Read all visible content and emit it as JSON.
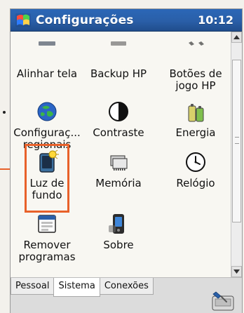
{
  "window": {
    "title": "Configurações",
    "clock": "10:12"
  },
  "items": [
    {
      "label": "Alinhar tela",
      "icon": "screen-align-icon"
    },
    {
      "label": "Backup HP",
      "icon": "backup-icon"
    },
    {
      "label": "Botões de\njogo HP",
      "icon": "game-buttons-icon"
    },
    {
      "label": "Configuraç...\nregionais",
      "icon": "regional-settings-icon"
    },
    {
      "label": "Contraste",
      "icon": "contrast-icon"
    },
    {
      "label": "Energia",
      "icon": "power-icon"
    },
    {
      "label": "Luz de\nfundo",
      "icon": "backlight-icon"
    },
    {
      "label": "Memória",
      "icon": "memory-icon"
    },
    {
      "label": "Relógio",
      "icon": "clock-icon"
    },
    {
      "label": "Remover\nprogramas",
      "icon": "remove-programs-icon"
    },
    {
      "label": "Sobre",
      "icon": "about-icon"
    }
  ],
  "tabs": [
    {
      "label": "Pessoal",
      "active": false
    },
    {
      "label": "Sistema",
      "active": true
    },
    {
      "label": "Conexões",
      "active": false
    }
  ],
  "colors": {
    "accent": "#e8612a",
    "titlebar": "#2a5fa8"
  },
  "highlight": {
    "item_index": 6
  }
}
